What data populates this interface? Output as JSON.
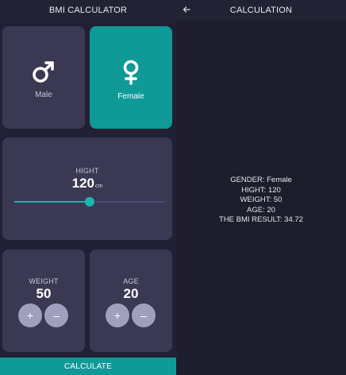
{
  "left_screen": {
    "title": "BMI CALCULATOR",
    "genders": [
      {
        "label": "Male",
        "selected": false
      },
      {
        "label": "Female",
        "selected": true
      }
    ],
    "height": {
      "label": "HIGHT",
      "value": "120",
      "unit": "cm",
      "slider_fraction": 0.5
    },
    "weight": {
      "label": "WEIGHT",
      "value": "50",
      "plus": "+",
      "minus": "–"
    },
    "age": {
      "label": "AGE",
      "value": "20",
      "plus": "+",
      "minus": "–"
    },
    "calculate_label": "CALCULATE"
  },
  "right_screen": {
    "title": "CALCULATION",
    "back_icon": "arrow-left-icon",
    "lines": [
      "GENDER: Female",
      "HIGHT: 120",
      "WEIGHT: 50",
      "AGE: 20",
      "THE BMI RESULT: 34.72"
    ]
  },
  "colors": {
    "background": "#222034",
    "card": "#3a3853",
    "accent": "#0f9a98",
    "slider": "#1fb3b1",
    "round_button": "#a19fbd"
  }
}
